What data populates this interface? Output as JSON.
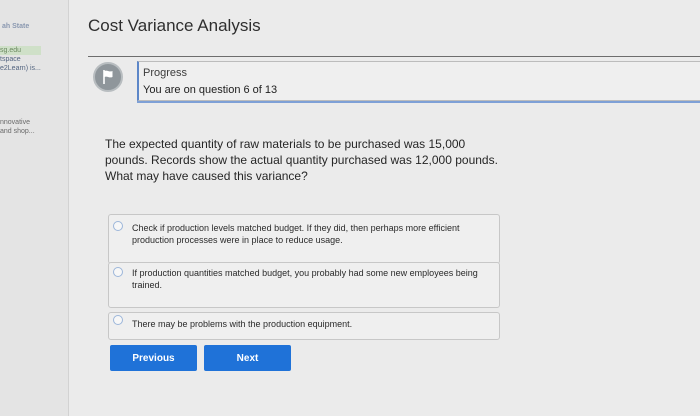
{
  "sidebar": {
    "logo_text": "ah State",
    "links": [
      "sg.edu",
      "tspace",
      "e2Learn) is..."
    ],
    "description": [
      "nnovative",
      "and shop..."
    ]
  },
  "page": {
    "title": "Cost Variance Analysis"
  },
  "progress": {
    "label": "Progress",
    "status": "You are on question 6 of 13"
  },
  "question": {
    "text": "The expected quantity of raw materials to be purchased was 15,000 pounds. Records show the actual quantity purchased was 12,000 pounds. What may have caused this variance?"
  },
  "options": [
    {
      "label": "Check if production levels matched budget. If they did, then perhaps more efficient production processes were in place to reduce usage."
    },
    {
      "label": "If production quantities matched budget, you probably had some new employees being trained."
    },
    {
      "label": "There may be problems with the production equipment."
    }
  ],
  "buttons": {
    "previous": "Previous",
    "next": "Next"
  },
  "colors": {
    "accent": "#1f72d8",
    "progress_border": "#5c86c8"
  }
}
